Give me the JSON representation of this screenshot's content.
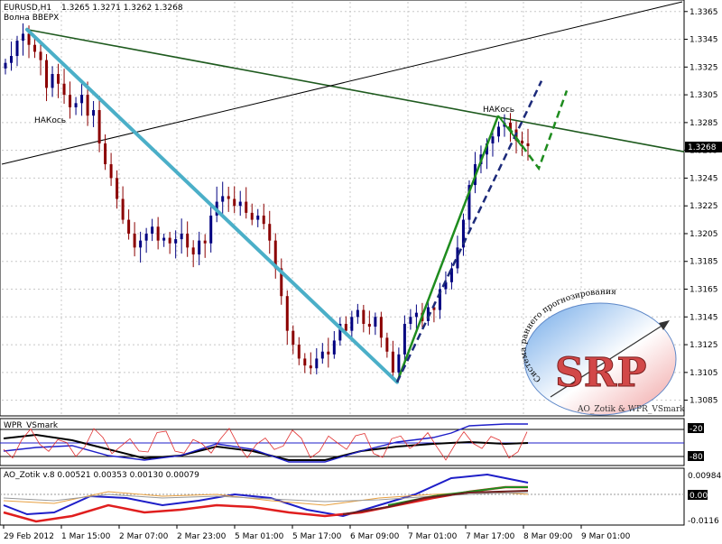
{
  "header": {
    "symbol": "EURUSD,H1",
    "ohlc": "1.3265 1.3271 1.3262 1.3268"
  },
  "annotations": {
    "wave_up": "Волна ВВЕРХ",
    "nakos_left": "НАКось",
    "nakos_right": "НАКось"
  },
  "price_badge": "1.3268",
  "logo": {
    "letters": "SRP",
    "arc_text": "Система раннего прогнозирования",
    "bottom_text": "AO_Zotik & WPR_VSmark"
  },
  "indicators": {
    "wpr_title": "WPR_VSmark",
    "wpr_levels": [
      "-20",
      "-80"
    ],
    "ao_title": "AO_Zotik v.8 0.00521 0.00353 0.00130 0.00079",
    "ao_levels": [
      "0.00984",
      "0.00",
      "-0.0116"
    ]
  },
  "chart_data": {
    "type": "candlestick",
    "title": "EURUSD,H1",
    "y_ticks": [
      "1.3365",
      "1.3345",
      "1.3325",
      "1.3305",
      "1.3285",
      "1.3265",
      "1.3245",
      "1.3225",
      "1.3205",
      "1.3185",
      "1.3165",
      "1.3145",
      "1.3125",
      "1.3105",
      "1.3085"
    ],
    "x_ticks": [
      "29 Feb 2012",
      "1 Mar 15:00",
      "2 Mar 07:00",
      "2 Mar 23:00",
      "5 Mar 01:00",
      "5 Mar 17:00",
      "6 Mar 09:00",
      "7 Mar 01:00",
      "7 Mar 17:00",
      "8 Mar 09:00",
      "9 Mar 01:00"
    ],
    "ylim": [
      1.3075,
      1.3372
    ],
    "grid": true,
    "close_path": [
      1.3328,
      1.3333,
      1.3344,
      1.3349,
      1.3341,
      1.3336,
      1.333,
      1.331,
      1.332,
      1.3313,
      1.3305,
      1.3296,
      1.3299,
      1.3305,
      1.329,
      1.3294,
      1.327,
      1.3255,
      1.3245,
      1.323,
      1.3215,
      1.3205,
      1.3195,
      1.32,
      1.3205,
      1.321,
      1.32,
      1.3202,
      1.3198,
      1.3201,
      1.3205,
      1.3195,
      1.319,
      1.32,
      1.3198,
      1.3218,
      1.3228,
      1.3232,
      1.323,
      1.3225,
      1.3228,
      1.322,
      1.3215,
      1.3218,
      1.3212,
      1.32,
      1.318,
      1.316,
      1.3135,
      1.3125,
      1.3115,
      1.311,
      1.3108,
      1.3115,
      1.312,
      1.3118,
      1.3128,
      1.314,
      1.3135,
      1.3145,
      1.315,
      1.314,
      1.3138,
      1.3145,
      1.313,
      1.312,
      1.3105,
      1.3118,
      1.314,
      1.3145,
      1.3148,
      1.3142,
      1.3152,
      1.315,
      1.3165,
      1.317,
      1.318,
      1.3195,
      1.3215,
      1.324,
      1.3255,
      1.3262,
      1.327,
      1.3275,
      1.3282,
      1.3285,
      1.328,
      1.3272,
      1.327,
      1.3268
    ],
    "trendlines": [
      {
        "name": "resistance",
        "from": [
          0,
          1.3352
        ],
        "to": [
          1,
          1.3265
        ]
      },
      {
        "name": "channel",
        "from": [
          0,
          1.3255
        ],
        "to": [
          1,
          1.3372
        ]
      }
    ]
  },
  "colors": {
    "bull": "#000080",
    "bear": "#8B0000",
    "wave_down": "#4BAFC8",
    "wave_up": "#1E8C1E",
    "forecast_blue": "#1C2A7A",
    "forecast_green": "#1E8C1E",
    "trend_dark": "#1E5A1E",
    "grid": "#C8C8C8"
  }
}
